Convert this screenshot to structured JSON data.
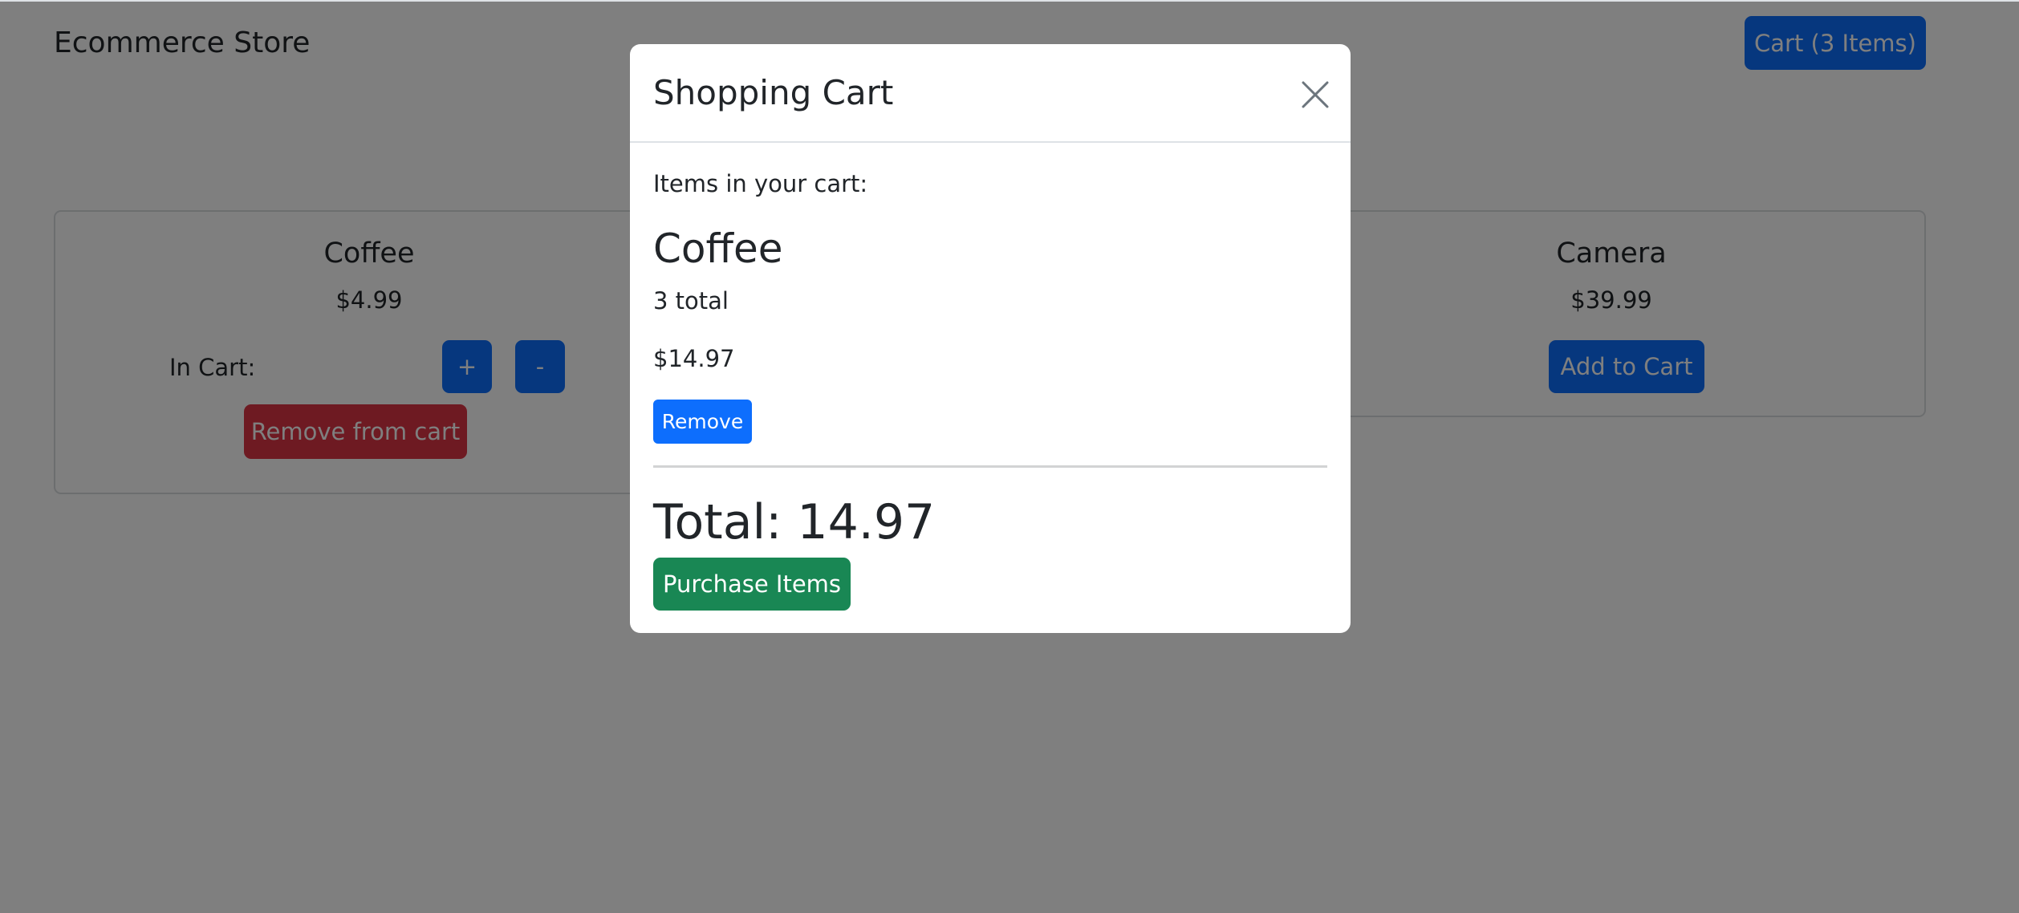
{
  "navbar": {
    "brand": "Ecommerce Store",
    "cart_button_label": "Cart (3 Items)"
  },
  "products": [
    {
      "name": "Coffee",
      "price": "$4.99",
      "in_cart_label": "In Cart:",
      "increment_label": "+",
      "decrement_label": "-",
      "remove_label": "Remove from cart"
    },
    {
      "name": "Camera",
      "price": "$39.99",
      "add_label": "Add to Cart"
    }
  ],
  "modal": {
    "title": "Shopping Cart",
    "close_icon": "close-icon",
    "items_label": "Items in your cart:",
    "items": [
      {
        "name": "Coffee",
        "count_text": "3 total",
        "price": "$14.97",
        "remove_label": "Remove"
      }
    ],
    "total_text": "Total: 14.97",
    "purchase_label": "Purchase Items"
  },
  "colors": {
    "primary": "#0d6efd",
    "danger": "#dc3545",
    "success": "#198754",
    "backdrop": "rgba(0,0,0,0.5)"
  }
}
